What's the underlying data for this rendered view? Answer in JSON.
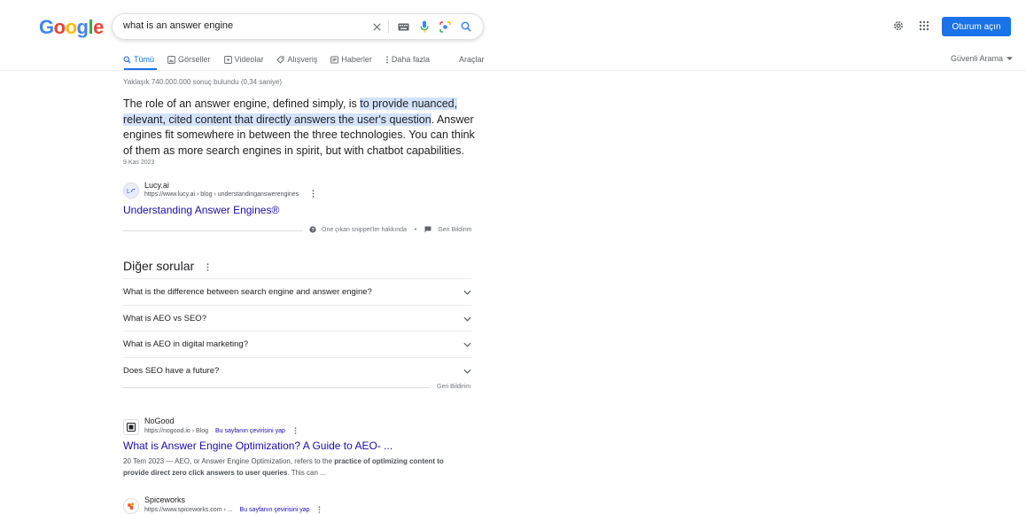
{
  "logo": {
    "letters": [
      "G",
      "o",
      "o",
      "g",
      "l",
      "e"
    ],
    "colors": [
      "#4285f4",
      "#ea4335",
      "#fbbc05",
      "#4285f4",
      "#34a853",
      "#ea4335"
    ]
  },
  "search": {
    "query": "what is an answer engine",
    "icons": [
      "close-icon",
      "keyboard-icon",
      "mic-icon",
      "lens-icon",
      "search-icon"
    ]
  },
  "header": {
    "signin_label": "Oturum açın"
  },
  "tabs": [
    {
      "label": "Tümü",
      "icon": "search-icon"
    },
    {
      "label": "Görseller",
      "icon": "image-icon"
    },
    {
      "label": "Videolar",
      "icon": "video-icon"
    },
    {
      "label": "Alışveriş",
      "icon": "tag-icon"
    },
    {
      "label": "Haberler",
      "icon": "news-icon"
    },
    {
      "label": "Daha fazla",
      "icon": "more-icon"
    },
    {
      "label": "Araçlar",
      "icon": ""
    }
  ],
  "safesearch_label": "Güvenli Arama",
  "result_count": "Yaklaşık 740.000.000 sonuç bulundu (0,34 saniye)",
  "featured": {
    "text_before": "The role of an answer engine, defined simply, is ",
    "text_highlight": "to provide nuanced, relevant, cited content that directly answers the user's question",
    "text_after": ". Answer engines fit somewhere in between the three technologies. You can think of them as more search engines in spirit, but with chatbot capabilities.",
    "date": "9 Kas 2023",
    "site_name": "Lucy.ai",
    "site_url": "https://www.lucy.ai › blog › understandinganswerengines",
    "title": "Understanding Answer Engines®",
    "about_label": "Öne çıkan snippet'ler hakkında",
    "feedback_label": "Geri Bildirim"
  },
  "paa": {
    "title": "Diğer sorular",
    "questions": [
      "What is the difference between search engine and answer engine?",
      "What is AEO vs SEO?",
      "What is AEO in digital marketing?",
      "Does SEO have a future?"
    ],
    "feedback_label": "Geri Bildirim"
  },
  "results": [
    {
      "site_name": "NoGood",
      "site_url": "https://nogood.io › Blog",
      "translate_label": "Bu sayfanın çevirisini yap",
      "title": "What is Answer Engine Optimization? A Guide to AEO- ...",
      "date": "20 Tem 2023",
      "desc_before": " — AEO, or Answer Engine Optimization, refers to the ",
      "desc_bold": "practice of optimizing content to provide direct zero click answers to user queries",
      "desc_after": ". This can ..."
    },
    {
      "site_name": "Spiceworks",
      "site_url": "https://www.spiceworks.com › ...",
      "translate_label": "Bu sayfanın çevirisini yap"
    }
  ]
}
